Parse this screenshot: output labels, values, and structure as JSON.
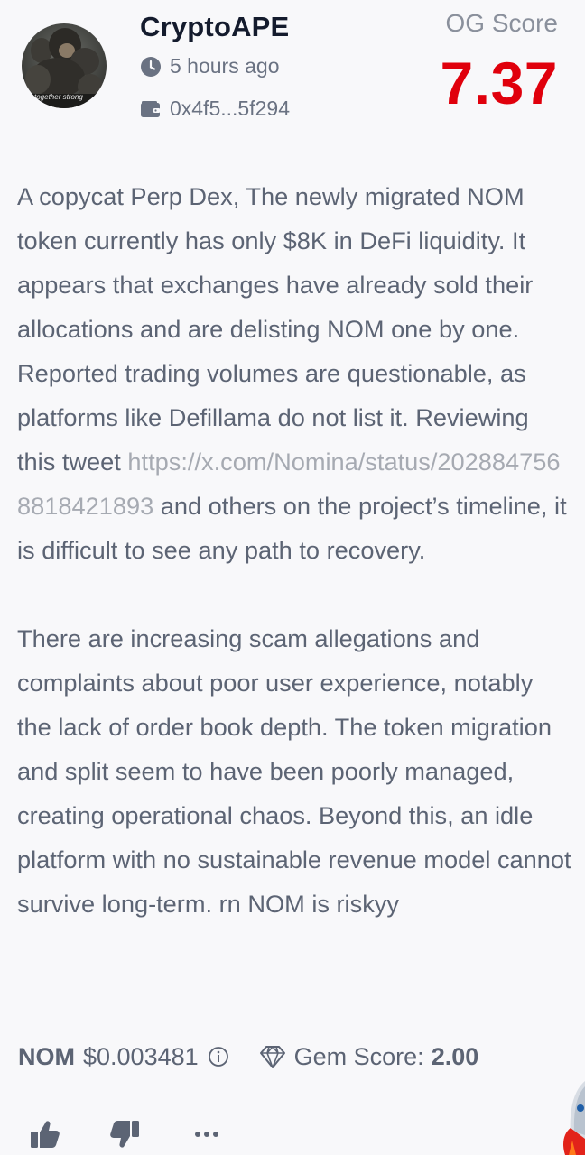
{
  "post": {
    "author": {
      "name": "CryptoAPE",
      "avatar_caption": "together strong"
    },
    "time_ago": "5 hours ago",
    "wallet": "0x4f5...5f294",
    "og_score": {
      "label": "OG Score",
      "value": "7.37"
    },
    "body": {
      "p1_text": "A copycat Perp Dex, The newly migrated NOM token currently has only $8K in DeFi liquidity. It appears that exchanges have already sold their allocations and are delisting NOM one by one. Reported trading volumes are questionable, as platforms like Defillama do not list it. Reviewing this tweet ",
      "p1_link": "https://x.com/Nomina/status/2028847568818421893",
      "p1_tail": " and others on the project’s timeline, it is difficult to see any path to recovery.",
      "p2_text": "There are increasing scam allegations and complaints about poor user experience, notably the lack of order book depth. The token migration and split seem to have been poorly managed, creating operational chaos. Beyond this, an idle platform with no sustainable revenue model cannot survive long-term. rn NOM is riskyy"
    },
    "token": {
      "symbol": "NOM",
      "price": "$0.003481",
      "gem_score_label": "Gem Score:",
      "gem_score_value": "2.00"
    },
    "actions": {
      "like_icon": "thumbs-up-icon",
      "dislike_icon": "thumbs-down-icon",
      "more_icon": "more-dots-icon"
    }
  },
  "colors": {
    "og_score": "#e0000c",
    "username": "#141b2d",
    "body_text": "#5c6474",
    "link": "#a6aab2",
    "background": "#f8f8fa"
  }
}
